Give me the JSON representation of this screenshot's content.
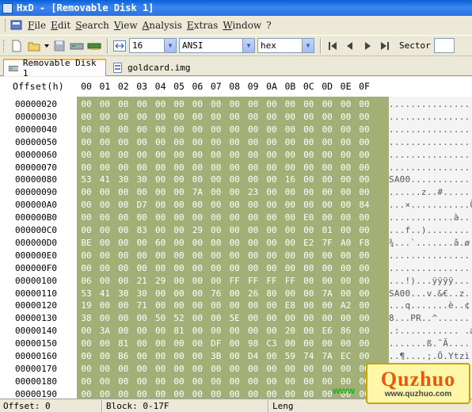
{
  "window": {
    "title": "HxD - [Removable Disk 1]"
  },
  "menu": {
    "items": [
      "File",
      "Edit",
      "Search",
      "View",
      "Analysis",
      "Extras",
      "Window",
      "?"
    ]
  },
  "toolbar": {
    "bytes_per_row": "16",
    "charset": "ANSI",
    "offset_base": "hex",
    "sector_label": "Sector"
  },
  "tabs": [
    {
      "label": "Removable Disk 1",
      "active": true
    },
    {
      "label": "goldcard.img",
      "active": false
    }
  ],
  "editor": {
    "offset_header": "Offset(h)",
    "columns": [
      "00",
      "01",
      "02",
      "03",
      "04",
      "05",
      "06",
      "07",
      "08",
      "09",
      "0A",
      "0B",
      "0C",
      "0D",
      "0E",
      "0F"
    ],
    "rows": [
      {
        "offset": "00000020",
        "bytes": [
          "00",
          "00",
          "00",
          "00",
          "00",
          "00",
          "00",
          "00",
          "00",
          "00",
          "00",
          "00",
          "00",
          "00",
          "00",
          "00"
        ],
        "ascii": "................"
      },
      {
        "offset": "00000030",
        "bytes": [
          "00",
          "00",
          "00",
          "00",
          "00",
          "00",
          "00",
          "00",
          "00",
          "00",
          "00",
          "00",
          "00",
          "00",
          "00",
          "00"
        ],
        "ascii": "................"
      },
      {
        "offset": "00000040",
        "bytes": [
          "00",
          "00",
          "00",
          "00",
          "00",
          "00",
          "00",
          "00",
          "00",
          "00",
          "00",
          "00",
          "00",
          "00",
          "00",
          "00"
        ],
        "ascii": "................"
      },
      {
        "offset": "00000050",
        "bytes": [
          "00",
          "00",
          "00",
          "00",
          "00",
          "00",
          "00",
          "00",
          "00",
          "00",
          "00",
          "00",
          "00",
          "00",
          "00",
          "00"
        ],
        "ascii": "................"
      },
      {
        "offset": "00000060",
        "bytes": [
          "00",
          "00",
          "00",
          "00",
          "00",
          "00",
          "00",
          "00",
          "00",
          "00",
          "00",
          "00",
          "00",
          "00",
          "00",
          "00"
        ],
        "ascii": "................"
      },
      {
        "offset": "00000070",
        "bytes": [
          "00",
          "00",
          "00",
          "00",
          "00",
          "00",
          "00",
          "00",
          "00",
          "00",
          "00",
          "00",
          "00",
          "00",
          "00",
          "00"
        ],
        "ascii": "................"
      },
      {
        "offset": "00000080",
        "bytes": [
          "53",
          "41",
          "30",
          "30",
          "00",
          "00",
          "00",
          "00",
          "00",
          "00",
          "00",
          "16",
          "00",
          "00",
          "00",
          "00"
        ],
        "ascii": "SA00............"
      },
      {
        "offset": "00000090",
        "bytes": [
          "00",
          "00",
          "00",
          "00",
          "00",
          "00",
          "7A",
          "00",
          "00",
          "23",
          "00",
          "00",
          "00",
          "00",
          "00",
          "00"
        ],
        "ascii": "......z..#......"
      },
      {
        "offset": "000000A0",
        "bytes": [
          "00",
          "00",
          "00",
          "D7",
          "00",
          "00",
          "00",
          "00",
          "00",
          "00",
          "00",
          "00",
          "00",
          "00",
          "00",
          "84"
        ],
        "ascii": "...×...........Õ"
      },
      {
        "offset": "000000B0",
        "bytes": [
          "00",
          "00",
          "00",
          "00",
          "00",
          "00",
          "00",
          "00",
          "00",
          "00",
          "00",
          "00",
          "E0",
          "00",
          "00",
          "00"
        ],
        "ascii": "............à..."
      },
      {
        "offset": "000000C0",
        "bytes": [
          "00",
          "00",
          "00",
          "83",
          "00",
          "00",
          "29",
          "00",
          "00",
          "00",
          "00",
          "00",
          "00",
          "01",
          "00",
          "00"
        ],
        "ascii": "...f..)........."
      },
      {
        "offset": "000000D0",
        "bytes": [
          "BE",
          "00",
          "00",
          "00",
          "60",
          "00",
          "00",
          "00",
          "00",
          "00",
          "00",
          "00",
          "E2",
          "7F",
          "A0",
          "F8"
        ],
        "ascii": "¾...`.......â.ø"
      },
      {
        "offset": "000000E0",
        "bytes": [
          "00",
          "00",
          "00",
          "00",
          "00",
          "00",
          "00",
          "00",
          "00",
          "00",
          "00",
          "00",
          "00",
          "00",
          "00",
          "00"
        ],
        "ascii": "................"
      },
      {
        "offset": "000000F0",
        "bytes": [
          "00",
          "00",
          "00",
          "00",
          "00",
          "00",
          "00",
          "00",
          "00",
          "00",
          "00",
          "00",
          "00",
          "00",
          "00",
          "00"
        ],
        "ascii": "................"
      },
      {
        "offset": "00000100",
        "bytes": [
          "06",
          "00",
          "00",
          "21",
          "29",
          "00",
          "00",
          "00",
          "FF",
          "FF",
          "FF",
          "FF",
          "00",
          "00",
          "00",
          "00"
        ],
        "ascii": "...!)...ÿÿÿÿ...."
      },
      {
        "offset": "00000110",
        "bytes": [
          "53",
          "41",
          "30",
          "30",
          "00",
          "00",
          "00",
          "76",
          "00",
          "26",
          "80",
          "00",
          "00",
          "7A",
          "00",
          "00"
        ],
        "ascii": "SA00...v.&€..z.."
      },
      {
        "offset": "00000120",
        "bytes": [
          "19",
          "00",
          "00",
          "71",
          "00",
          "00",
          "00",
          "00",
          "00",
          "00",
          "00",
          "E8",
          "00",
          "00",
          "A2",
          "00"
        ],
        "ascii": "...q.......è..¢."
      },
      {
        "offset": "00000130",
        "bytes": [
          "38",
          "00",
          "00",
          "00",
          "50",
          "52",
          "00",
          "00",
          "5E",
          "00",
          "00",
          "00",
          "00",
          "00",
          "00",
          "00"
        ],
        "ascii": "8...PR..^......."
      },
      {
        "offset": "00000140",
        "bytes": [
          "00",
          "3A",
          "00",
          "00",
          "00",
          "81",
          "00",
          "00",
          "00",
          "00",
          "00",
          "20",
          "00",
          "E6",
          "86",
          "00"
        ],
        "ascii": ".:........... .æ."
      },
      {
        "offset": "00000150",
        "bytes": [
          "00",
          "00",
          "81",
          "00",
          "00",
          "00",
          "00",
          "DF",
          "00",
          "98",
          "C3",
          "00",
          "00",
          "00",
          "00",
          "00"
        ],
        "ascii": ".......ß.˜Ã....."
      },
      {
        "offset": "00000160",
        "bytes": [
          "00",
          "00",
          "B6",
          "00",
          "00",
          "00",
          "00",
          "3B",
          "00",
          "D4",
          "00",
          "59",
          "74",
          "7A",
          "EC",
          "00"
        ],
        "ascii": "..¶....;.Ô.Ytzì."
      },
      {
        "offset": "00000170",
        "bytes": [
          "00",
          "00",
          "00",
          "00",
          "00",
          "00",
          "00",
          "00",
          "00",
          "00",
          "00",
          "00",
          "00",
          "00",
          "00",
          "00"
        ],
        "ascii": "................"
      },
      {
        "offset": "00000180",
        "bytes": [
          "00",
          "00",
          "00",
          "00",
          "00",
          "00",
          "00",
          "00",
          "00",
          "00",
          "00",
          "00",
          "00",
          "00",
          "00",
          "00"
        ],
        "ascii": "................"
      },
      {
        "offset": "00000190",
        "bytes": [
          "00",
          "00",
          "00",
          "00",
          "00",
          "00",
          "00",
          "00",
          "00",
          "00",
          "00",
          "00",
          "00",
          "00",
          "00",
          "00"
        ],
        "ascii": "................"
      }
    ]
  },
  "status": {
    "offset": "Offset: 0",
    "block": "Block: 0-17F",
    "length": "Leng"
  },
  "watermark": {
    "brand": "Quzhuo",
    "url": "www.quzhuo.com",
    "green": "www"
  }
}
